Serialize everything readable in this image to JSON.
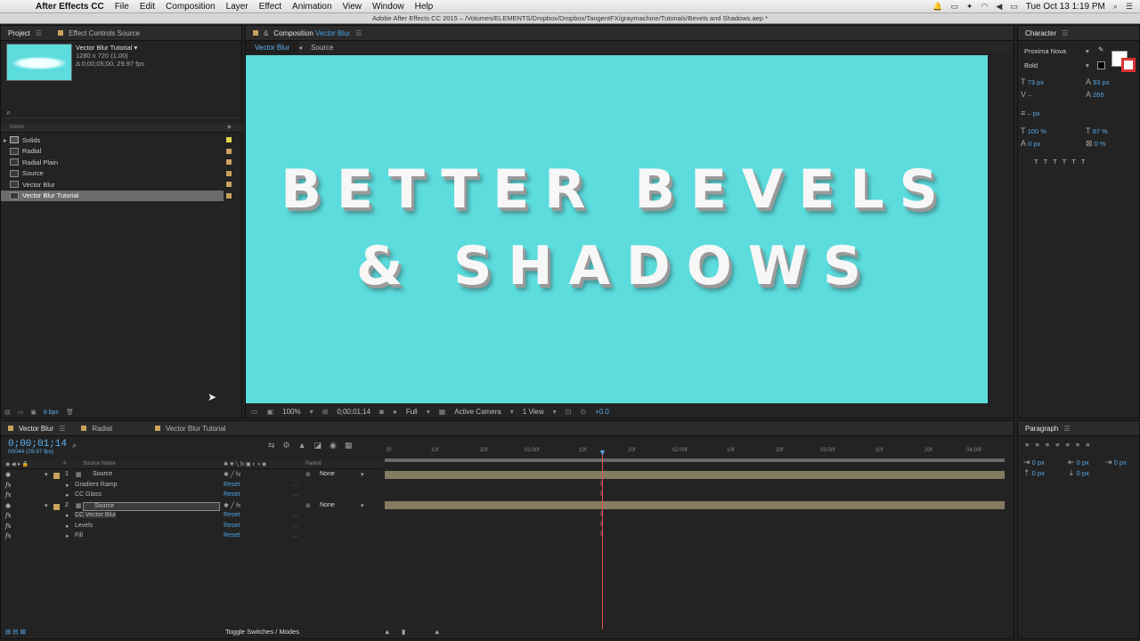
{
  "menubar": {
    "app": "After Effects CC",
    "items": [
      "File",
      "Edit",
      "Composition",
      "Layer",
      "Effect",
      "Animation",
      "View",
      "Window",
      "Help"
    ],
    "clock": "Tue Oct 13  1:19 PM"
  },
  "window_title": "Adobe After Effects CC 2015 – /Volumes/ELEMENTS/Dropbox/Dropbox/TangentFX/graymachine/Tutorials/Bevels and Shadows.aep *",
  "project": {
    "tab_label": "Project",
    "tab2_label": "Effect Controls Source",
    "selected_name": "Vector Blur Tutorial ▾",
    "selected_line2": "1280 x 720 (1.00)",
    "selected_line3": "Δ 0;00;05;00, 29.97 fps",
    "search_icon": "⌕",
    "col_name": "Name",
    "items": [
      {
        "name": "Solids",
        "type": "folder",
        "label": "yellow"
      },
      {
        "name": "Radial",
        "type": "comp",
        "label": "tan"
      },
      {
        "name": "Radial Plain",
        "type": "comp",
        "label": "tan"
      },
      {
        "name": "Source",
        "type": "comp",
        "label": "tan"
      },
      {
        "name": "Vector Blur",
        "type": "comp",
        "label": "tan"
      },
      {
        "name": "Vector Blur Tutorial",
        "type": "comp",
        "label": "tan",
        "selected": true
      }
    ],
    "bpc": "8 bpc"
  },
  "composition": {
    "tab_prefix": "Composition",
    "tab_name": "Vector Blur",
    "crumb1": "Vector Blur",
    "crumb2": "Source",
    "title_line1": "BETTER BEVELS",
    "title_line2": "& SHADOWS",
    "bg_color": "#5cdcdd",
    "zoom": "100%",
    "timecode": "0;00;01;14",
    "resolution": "Full",
    "camera": "Active Camera",
    "views": "1 View",
    "exposure": "+0.0"
  },
  "character": {
    "tab_label": "Character",
    "font": "Proxima Nova",
    "style": "Bold",
    "size": "73 px",
    "leading": "93 px",
    "kerning": "–",
    "tracking": "265",
    "stroke": "– px",
    "vscale": "100 %",
    "hscale": "97 %",
    "baseline": "0 px",
    "tsume": "0 %"
  },
  "timeline": {
    "tabs": [
      "Vector Blur",
      "Radial",
      "Vector Blur Tutorial"
    ],
    "timecode": "0;00;01;14",
    "timesub": "00044 (29.97 fps)",
    "col_source": "Source Name",
    "col_parent": "Parent",
    "rows": [
      {
        "kind": "layer",
        "num": "1",
        "name": "Source",
        "parent": "None"
      },
      {
        "kind": "effect",
        "name": "Gradient Ramp",
        "reset": "Reset",
        "dots": "..."
      },
      {
        "kind": "effect",
        "name": "CC Glass",
        "reset": "Reset",
        "dots": "..."
      },
      {
        "kind": "layer",
        "num": "2",
        "name": "Source",
        "parent": "None",
        "selected": true
      },
      {
        "kind": "effect",
        "name": "CC Vector Blur",
        "reset": "Reset",
        "dots": "..."
      },
      {
        "kind": "effect",
        "name": "Levels",
        "reset": "Reset",
        "dots": "..."
      },
      {
        "kind": "effect",
        "name": "Fill",
        "reset": "Reset",
        "dots": "..."
      }
    ],
    "ruler": [
      "0f",
      "10f",
      "20f",
      "01:00f",
      "10f",
      "20f",
      "02:00f",
      "10f",
      "20f",
      "03:00f",
      "10f",
      "20f",
      "04:00f"
    ],
    "toggle_label": "Toggle Switches / Modes"
  },
  "paragraph": {
    "tab_label": "Paragraph",
    "indent_left": "0 px",
    "indent_right": "0 px",
    "indent_first": "0 px",
    "space_before": "0 px",
    "space_after": "0 px"
  }
}
